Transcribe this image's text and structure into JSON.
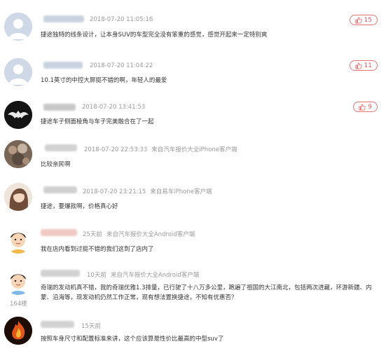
{
  "comments": [
    {
      "time": "2018-07-20 11:05:16",
      "source": "",
      "text": "捷途独特的线条设计，让本身SUV的车型完全没有笨重的感觉，感觉开起来一定特别爽",
      "likes": "15",
      "avatar": "default-avatar"
    },
    {
      "time": "2018-07-20 11:04:22",
      "source": "",
      "text": "10.1英寸的中控大屏挺不错的啊，年轻人的最爱",
      "likes": "11",
      "avatar": "default-avatar"
    },
    {
      "time": "2018-07-20 13:41:53",
      "source": "",
      "text": "捷途车子侧面棱角与车子完美融合在了一起",
      "likes": "9",
      "avatar": "bat-avatar"
    },
    {
      "time": "2018-07-20 22:53:33",
      "source": "来自汽车报价大全iPhone客户端",
      "text": "比较亲民啊",
      "likes": "",
      "avatar": "photo-avatar"
    },
    {
      "time": "2018-07-20 23:21:15",
      "source": "来自易车iPhone客户端",
      "text": "捷途，要爆款啊，价格真心好",
      "likes": "",
      "avatar": "girl-avatar"
    },
    {
      "time": "25天前",
      "source": "来自汽车报价大全Android客户端",
      "text": "我在店内看到过挺不错的我们这到了店内了",
      "likes": "",
      "avatar": "cartoon-avatar"
    },
    {
      "time": "10天前",
      "source": "来自汽车报价大全Android客户端",
      "text": "奇瑞的发动机真不错，我的奇瑞优雅1.3排量，已行驶了十八万多公里，跑遍了祖国的大江南北，包括两次进藏，环游新疆、内蒙、沿海等，现发动机仍然工作正常，现有想法置换捷途，不知有优惠否？",
      "likes": "",
      "avatar": "cartoon-avatar",
      "floor": "164楼"
    },
    {
      "time": "15天前",
      "source": "",
      "text": "按照车身尺寸和配置标准来讲，这个应该算是性价比最高的中型suv了",
      "likes": "",
      "avatar": "fire-avatar"
    }
  ],
  "colors": {
    "accent": "#e45959",
    "meta": "#999999",
    "text": "#333333"
  }
}
